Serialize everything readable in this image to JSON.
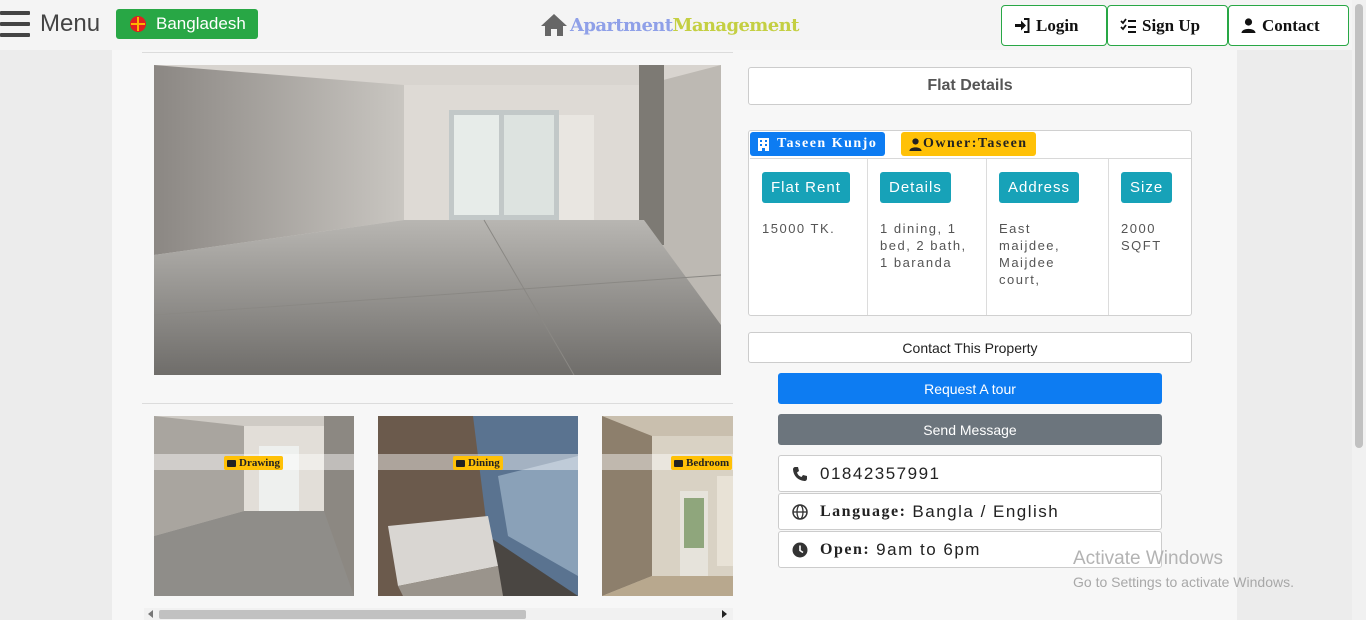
{
  "header": {
    "menu_label": "Menu",
    "country_label": "Bangladesh",
    "brand_part1": "Apartment",
    "brand_part2": "Management",
    "nav": [
      {
        "label": "Login",
        "icon": "login-icon"
      },
      {
        "label": "Sign Up",
        "icon": "signup-icon"
      },
      {
        "label": "Contact",
        "icon": "user-icon"
      }
    ]
  },
  "gallery": {
    "thumbnails": [
      {
        "tag": "Drawing"
      },
      {
        "tag": "Dining"
      },
      {
        "tag": "Bedroom"
      }
    ]
  },
  "details": {
    "title": "Flat Details",
    "building": "Taseen Kunjo",
    "owner": "Owner:Taseen",
    "columns": [
      {
        "label": "Flat Rent",
        "value": "15000 TK."
      },
      {
        "label": "Details",
        "value": "1 dining, 1 bed, 2 bath, 1 baranda"
      },
      {
        "label": "Address",
        "value": "East maijdee, Maijdee court,"
      },
      {
        "label": "Size",
        "value": "2000 SQFT"
      }
    ]
  },
  "contact": {
    "heading": "Contact This Property",
    "request_tour": "Request A tour",
    "send_message": "Send Message",
    "phone": "01842357991",
    "language_label": "Language:",
    "language_value": "Bangla / English",
    "open_label": "Open:",
    "open_value": "9am to 6pm"
  },
  "watermark": {
    "line1": "Activate Windows",
    "line2": "Go to Settings to activate Windows."
  },
  "colors": {
    "success": "#28a745",
    "primary": "#0d7cf2",
    "info": "#17a2b8",
    "warning": "#ffc107",
    "secondary": "#6c757d"
  }
}
